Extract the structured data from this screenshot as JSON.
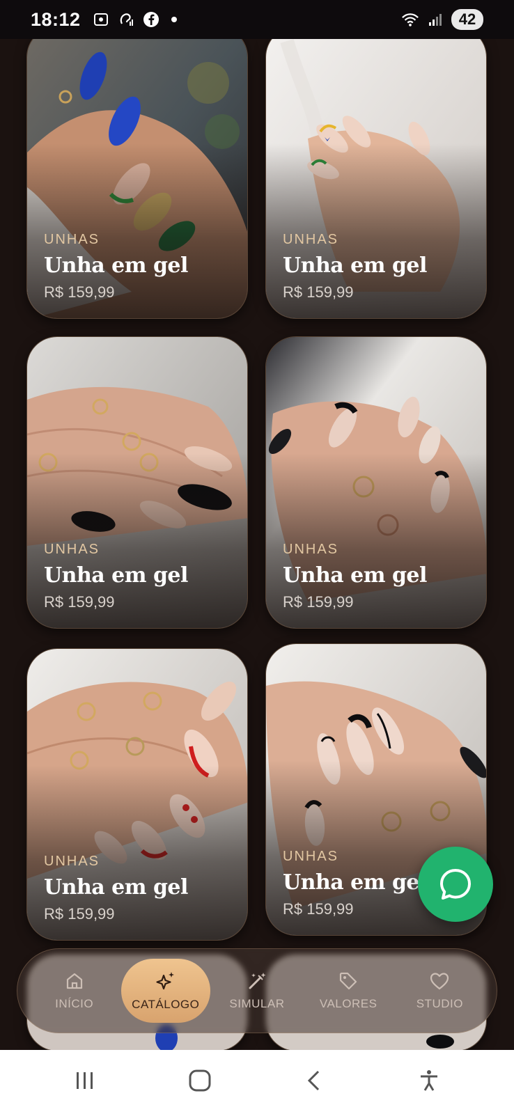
{
  "status": {
    "time": "18:12",
    "battery": "42"
  },
  "products": [
    {
      "category": "UNHAS",
      "name": "Unha em gel",
      "price": "R$ 159,99"
    },
    {
      "category": "UNHAS",
      "name": "Unha em gel",
      "price": "R$ 159,99"
    },
    {
      "category": "UNHAS",
      "name": "Unha em gel",
      "price": "R$ 159,99"
    },
    {
      "category": "UNHAS",
      "name": "Unha em gel",
      "price": "R$ 159,99"
    },
    {
      "category": "UNHAS",
      "name": "Unha em gel",
      "price": "R$ 159,99"
    },
    {
      "category": "UNHAS",
      "name": "Unha em gel",
      "price": "R$ 159,99"
    }
  ],
  "nav": {
    "items": [
      {
        "label": "INÍCIO",
        "icon": "home-icon"
      },
      {
        "label": "CATÁLOGO",
        "icon": "sparkles-icon",
        "active": true
      },
      {
        "label": "SIMULAR",
        "icon": "magic-wand-icon"
      },
      {
        "label": "VALORES",
        "icon": "tag-icon"
      },
      {
        "label": "STUDIO",
        "icon": "heart-icon"
      }
    ]
  },
  "colors": {
    "accent": "#e2c7a2",
    "whatsapp": "#21b36e",
    "background": "#1b1210"
  }
}
